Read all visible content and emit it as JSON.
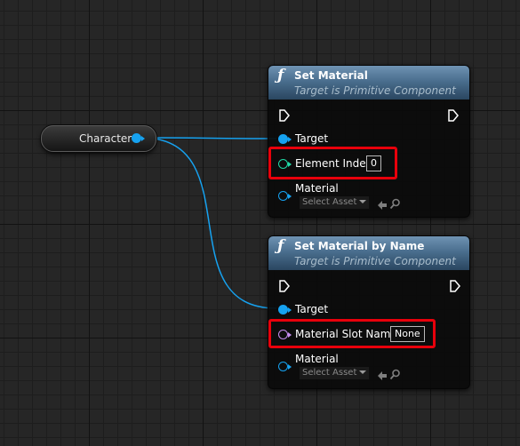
{
  "variable": {
    "label": "Character"
  },
  "nodes": [
    {
      "title": "Set Material",
      "subtitle": "Target is Primitive Component",
      "target_label": "Target",
      "param_label": "Element Index",
      "param_value": "0",
      "material_label": "Material",
      "asset_placeholder": "Select Asset"
    },
    {
      "title": "Set Material by Name",
      "subtitle": "Target is Primitive Component",
      "target_label": "Target",
      "param_label": "Material Slot Name",
      "param_value": "None",
      "material_label": "Material",
      "asset_placeholder": "Select Asset"
    }
  ],
  "icons": {
    "function": "ƒ",
    "function_icon": "function-icon",
    "exec_pin": "exec-pin-icon",
    "object_pin": "object-pin-icon",
    "use_asset": "left-arrow-icon",
    "browse_asset": "magnifier-icon"
  },
  "colors": {
    "object_pin": "#16a2f0",
    "integer_pin": "#20d9a6",
    "name_pin": "#c58cf0",
    "highlight": "#e8000b",
    "header": "#4a6e8e"
  }
}
